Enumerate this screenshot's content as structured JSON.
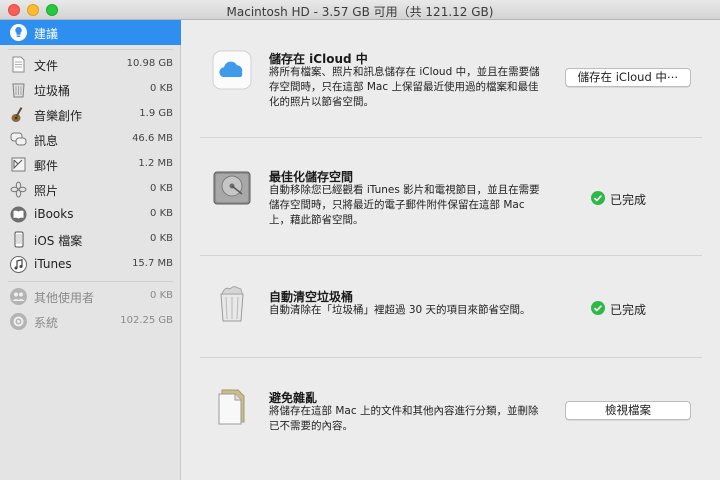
{
  "window": {
    "title": "Macintosh HD - 3.57 GB 可用（共 121.12 GB)"
  },
  "sidebar": {
    "items": [
      {
        "label": "建議",
        "size": "",
        "icon": "lightbulb-icon"
      },
      {
        "label": "文件",
        "size": "10.98 GB",
        "icon": "document-icon"
      },
      {
        "label": "垃圾桶",
        "size": "0 KB",
        "icon": "trash-icon"
      },
      {
        "label": "音樂創作",
        "size": "1.9 GB",
        "icon": "guitar-icon"
      },
      {
        "label": "訊息",
        "size": "46.6 MB",
        "icon": "messages-icon"
      },
      {
        "label": "郵件",
        "size": "1.2 MB",
        "icon": "mail-icon"
      },
      {
        "label": "照片",
        "size": "0 KB",
        "icon": "photos-icon"
      },
      {
        "label": "iBooks",
        "size": "0 KB",
        "icon": "ibooks-icon"
      },
      {
        "label": "iOS 檔案",
        "size": "0 KB",
        "icon": "iphone-icon"
      },
      {
        "label": "iTunes",
        "size": "15.7 MB",
        "icon": "itunes-icon"
      },
      {
        "label": "其他使用者",
        "size": "0 KB",
        "icon": "users-icon"
      },
      {
        "label": "系統",
        "size": "102.25 GB",
        "icon": "gear-icon"
      }
    ]
  },
  "recommendations": [
    {
      "title": "儲存在 iCloud 中",
      "desc": "將所有檔案、照片和訊息儲存在 iCloud 中，並且在需要儲存空間時，只在這部 Mac 上保留最近使用過的檔案和最佳化的照片以節省空間。",
      "action": "儲存在 iCloud 中⋯",
      "icon": "icloud-icon"
    },
    {
      "title": "最佳化儲存空間",
      "desc": "自動移除您已經觀看 iTunes 影片和電視節目，並且在需要儲存空間時，只將最近的電子郵件附件保留在這部 Mac 上，藉此節省空間。",
      "status": "已完成",
      "icon": "hard-drive-icon"
    },
    {
      "title": "自動清空垃圾桶",
      "desc": "自動清除在「垃圾桶」裡超過 30 天的項目來節省空間。",
      "status": "已完成",
      "icon": "trash-full-icon"
    },
    {
      "title": "避免雜亂",
      "desc": "將儲存在這部 Mac 上的文件和其他內容進行分類，並刪除已不需要的內容。",
      "action": "檢視檔案",
      "icon": "documents-icon"
    }
  ]
}
